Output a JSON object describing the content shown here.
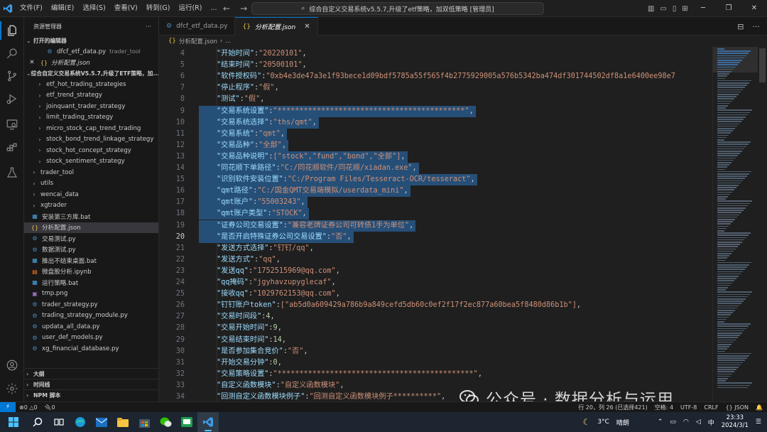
{
  "titlebar": {
    "menu": [
      "文件(F)",
      "编辑(E)",
      "选择(S)",
      "查看(V)",
      "转到(G)",
      "运行(R)",
      "..."
    ],
    "command_center": "综合自定义交易系统v5.5.7,升级了etf策略，加双低策略 [管理员]"
  },
  "sidebar": {
    "title": "资源管理器",
    "open_editors_label": "打开的编辑器",
    "open_editors": [
      {
        "name": "dfcf_etf_data.py",
        "desc": "trader_tool",
        "icon": "python-file-icon"
      },
      {
        "name": "分析配置.json",
        "desc": "",
        "icon": "json-file-icon",
        "close": "✕"
      }
    ],
    "workspace_label": "综合自定义交易系统V5.5.7,升级了ETF策略，加...",
    "tree": [
      {
        "name": "etf_hot_trading_strategies",
        "type": "folder",
        "indent": 2
      },
      {
        "name": "etf_trend_strategy",
        "type": "folder",
        "indent": 2
      },
      {
        "name": "joinquant_trader_strategy",
        "type": "folder",
        "indent": 2
      },
      {
        "name": "limit_trading_strategy",
        "type": "folder",
        "indent": 2
      },
      {
        "name": "micro_stock_cap_trend_trading",
        "type": "folder",
        "indent": 2
      },
      {
        "name": "stock_bond_trend_linkage_strategy",
        "type": "folder",
        "indent": 2
      },
      {
        "name": "stock_hot_concept_strategy",
        "type": "folder",
        "indent": 2
      },
      {
        "name": "stock_sentiment_strategy",
        "type": "folder",
        "indent": 2
      },
      {
        "name": "trader_tool",
        "type": "folder",
        "indent": 1
      },
      {
        "name": "utils",
        "type": "folder",
        "indent": 1
      },
      {
        "name": "wencai_data",
        "type": "folder",
        "indent": 1
      },
      {
        "name": "xgtrader",
        "type": "folder",
        "indent": 1
      },
      {
        "name": "安装第三方库.bat",
        "type": "bat",
        "indent": 1
      },
      {
        "name": "分析配置.json",
        "type": "json",
        "indent": 1,
        "selected": true
      },
      {
        "name": "交易测试.py",
        "type": "py",
        "indent": 1
      },
      {
        "name": "数据测试.py",
        "type": "py",
        "indent": 1
      },
      {
        "name": "推出不结束桌面.bat",
        "type": "bat",
        "indent": 1
      },
      {
        "name": "微盘股分析.ipynb",
        "type": "ipynb",
        "indent": 1
      },
      {
        "name": "运行策略.bat",
        "type": "bat",
        "indent": 1
      },
      {
        "name": "tmp.png",
        "type": "png",
        "indent": 1
      },
      {
        "name": "trader_strategy.py",
        "type": "py",
        "indent": 1
      },
      {
        "name": "trading_strategy_module.py",
        "type": "py",
        "indent": 1
      },
      {
        "name": "updata_all_data.py",
        "type": "py",
        "indent": 1
      },
      {
        "name": "user_def_models.py",
        "type": "py",
        "indent": 1
      },
      {
        "name": "xg_financial_database.py",
        "type": "py",
        "indent": 1
      }
    ],
    "outline_label": "大纲",
    "timeline_label": "时间线",
    "npm_label": "NPM 脚本"
  },
  "tabs": [
    {
      "name": "dfcf_etf_data.py",
      "active": false
    },
    {
      "name": "分析配置.json",
      "active": true,
      "close": "✕"
    }
  ],
  "breadcrumb": {
    "file": "分析配置.json",
    "more": "..."
  },
  "editor": {
    "current_line": 20,
    "lines": [
      {
        "num": 4,
        "key": "开始时间",
        "val": "\"20220101\"",
        "vt": "s",
        "sel": false
      },
      {
        "num": 5,
        "key": "结束时间",
        "val": "\"20500101\"",
        "vt": "s",
        "sel": false
      },
      {
        "num": 6,
        "key": "软件授权码",
        "val": "\"0xb4e3de47a3e1f93bece1d09bdf5785a55f565f4b2775929005a576b5342ba474df301744502df8a1e6400ee98e7",
        "vt": "s",
        "sel": false,
        "noend": true
      },
      {
        "num": 7,
        "key": "停止程序",
        "val": "\"假\"",
        "vt": "s",
        "sel": false
      },
      {
        "num": 8,
        "key": "测试",
        "val": "\"假\"",
        "vt": "s",
        "sel": false
      },
      {
        "num": 9,
        "key": "交易系统设置",
        "val": "\"*******************************************\"",
        "vt": "s",
        "sel": true
      },
      {
        "num": 10,
        "key": "交易系统选择",
        "val": "\"ths/qmt\"",
        "vt": "s",
        "sel": true
      },
      {
        "num": 11,
        "key": "交易系统",
        "val": "\"qmt\"",
        "vt": "s",
        "sel": true
      },
      {
        "num": 12,
        "key": "交易品种",
        "val": "\"全部\"",
        "vt": "s",
        "sel": true
      },
      {
        "num": 13,
        "key": "交易品种说明",
        "val": "[\"stock\",\"fund\",\"bond\",\"全部\"]",
        "vt": "arr",
        "sel": true
      },
      {
        "num": 14,
        "key": "同花顺下单路径",
        "val": "\"C:/同花顺软件/同花顺/xiadan.exe\"",
        "vt": "s",
        "sel": true
      },
      {
        "num": 15,
        "key": "识别软件安装位置",
        "val": "\"C:/Program Files/Tesseract-OCR/tesseract\"",
        "vt": "s",
        "sel": true
      },
      {
        "num": 16,
        "key": "qmt路径",
        "val": "\"C:/国金QMT交易端模拟/userdata_mini\"",
        "vt": "s",
        "sel": true
      },
      {
        "num": 17,
        "key": "qmt账户",
        "val": "\"55003243\"",
        "vt": "s",
        "sel": true
      },
      {
        "num": 18,
        "key": "qmt账户类型",
        "val": "\"STOCK\"",
        "vt": "s",
        "sel": true
      },
      {
        "num": 19,
        "key": "证券公司交易设置",
        "val": "\"兼容老牌证券公司可转债1手为单位\"",
        "vt": "s",
        "sel": true
      },
      {
        "num": 20,
        "key": "是否开启特殊证券公司交易设置",
        "val": "\"否\"",
        "vt": "s",
        "sel": true
      },
      {
        "num": 21,
        "key": "发送方式选择",
        "val": "\"钉钉/qq\"",
        "vt": "s",
        "sel": false
      },
      {
        "num": 22,
        "key": "发送方式",
        "val": "\"qq\"",
        "vt": "s",
        "sel": false
      },
      {
        "num": 23,
        "key": "发送qq",
        "val": "\"1752515969@qq.com\"",
        "vt": "s",
        "sel": false
      },
      {
        "num": 24,
        "key": "qq掩码",
        "val": "\"jgyhavzupyglecaf\"",
        "vt": "s",
        "sel": false
      },
      {
        "num": 25,
        "key": "接收qq",
        "val": "\"1029762153@qq.com\"",
        "vt": "s",
        "sel": false
      },
      {
        "num": 26,
        "key": "钉钉账户token",
        "val": "[\"ab5d0a609429a786b9a849cefd5db60c0ef2f17f2ec877a60bea5f8480d86b1b\"]",
        "vt": "arr",
        "sel": false
      },
      {
        "num": 27,
        "key": "交易时间段",
        "val": "4",
        "vt": "n",
        "sel": false
      },
      {
        "num": 28,
        "key": "交易开始时间",
        "val": "9",
        "vt": "n",
        "sel": false
      },
      {
        "num": 29,
        "key": "交易结束时间",
        "val": "14",
        "vt": "n",
        "sel": false
      },
      {
        "num": 30,
        "key": "是否参加集合竞价",
        "val": "\"否\"",
        "vt": "s",
        "sel": false
      },
      {
        "num": 31,
        "key": "开始交易分钟",
        "val": "0",
        "vt": "n",
        "sel": false
      },
      {
        "num": 32,
        "key": "交易策略设置",
        "val": "\"*********************************************\"",
        "vt": "s",
        "sel": false
      },
      {
        "num": 33,
        "key": "自定义函数模块",
        "val": "\"自定义函数模块\"",
        "vt": "s",
        "sel": false
      },
      {
        "num": 34,
        "key": "回测自定义函数模块例子",
        "val": "\"回测自定义函数模块例子**********\"",
        "vt": "s",
        "sel": false
      }
    ]
  },
  "statusbar": {
    "remote": "⚡",
    "errors": "⊗0 △0",
    "ports": "🔌0",
    "position": "行 20，列 26 (已选择421)",
    "spaces": "空格: 4",
    "encoding": "UTF-8",
    "eol": "CRLF",
    "language": "{} JSON"
  },
  "watermark": "公众号 · 数据分析与运用",
  "taskbar": {
    "weather_temp": "3°C",
    "weather_desc": "晴朗",
    "ime": "中",
    "time": "23:33",
    "date": "2024/3/1"
  }
}
